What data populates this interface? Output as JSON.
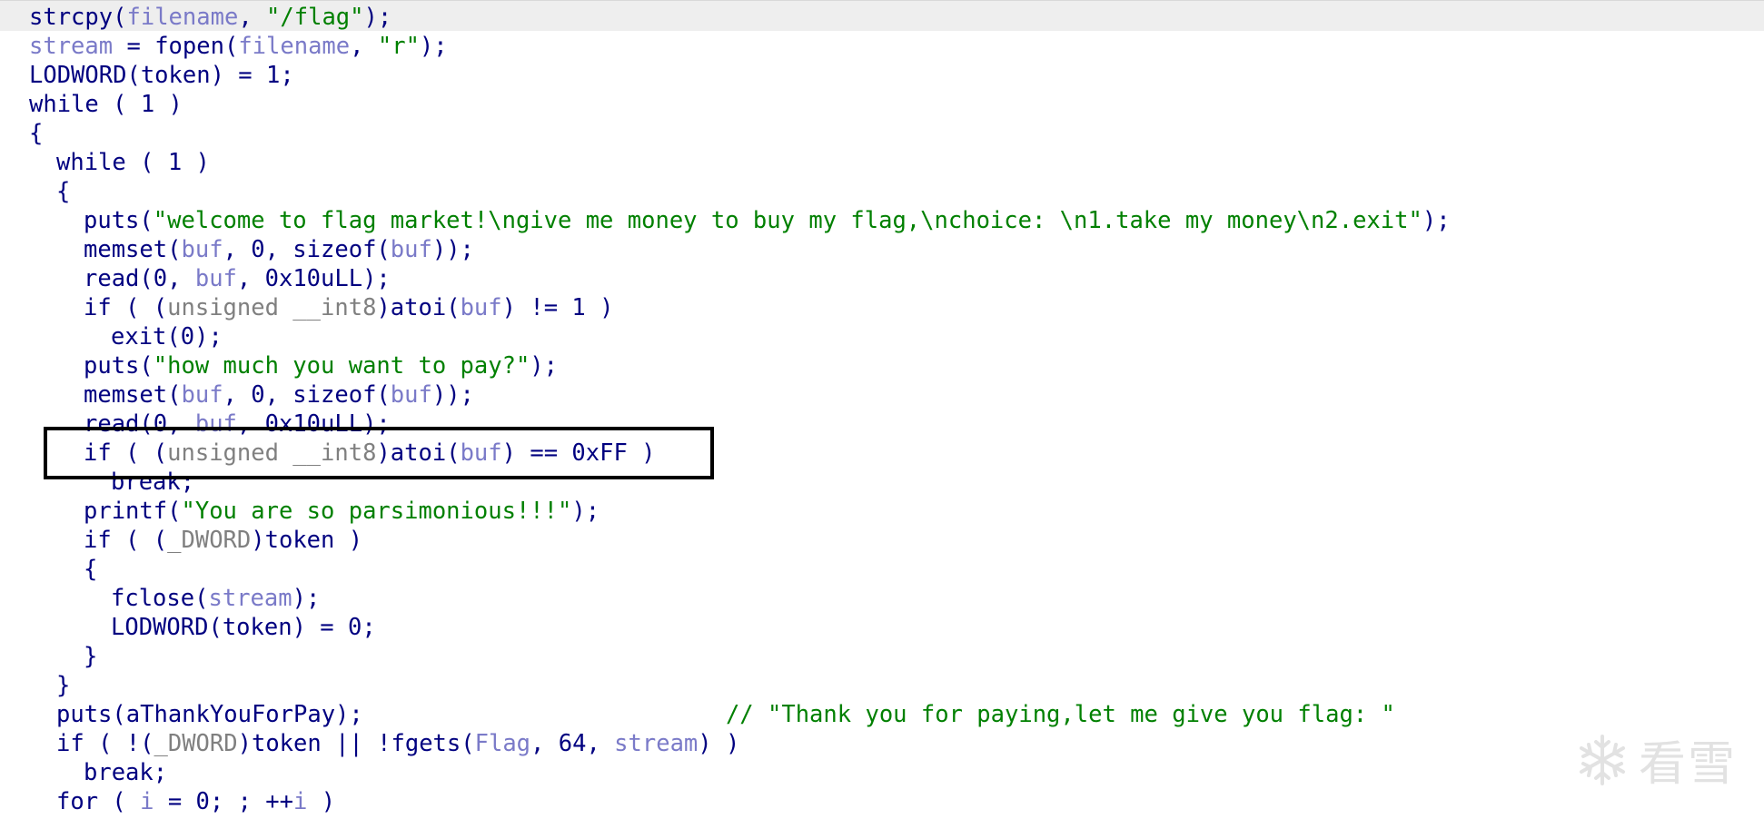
{
  "code_lines": [
    {
      "indent": 0,
      "tokens": [
        [
          "fn",
          "strcpy"
        ],
        [
          "p",
          "("
        ],
        [
          "var",
          "filename"
        ],
        [
          "p",
          ", "
        ],
        [
          "str",
          "\"/flag\""
        ],
        [
          "p",
          ");"
        ]
      ]
    },
    {
      "indent": 0,
      "tokens": [
        [
          "var",
          "stream"
        ],
        [
          "p",
          " = "
        ],
        [
          "fn",
          "fopen"
        ],
        [
          "p",
          "("
        ],
        [
          "var",
          "filename"
        ],
        [
          "p",
          ", "
        ],
        [
          "str",
          "\"r\""
        ],
        [
          "p",
          ");"
        ]
      ]
    },
    {
      "indent": 0,
      "tokens": [
        [
          "fn",
          "LODWORD"
        ],
        [
          "p",
          "(token) = 1;"
        ]
      ]
    },
    {
      "indent": 0,
      "tokens": [
        [
          "kw",
          "while"
        ],
        [
          "p",
          " ( 1 )"
        ]
      ]
    },
    {
      "indent": 0,
      "tokens": [
        [
          "p",
          "{"
        ]
      ]
    },
    {
      "indent": 1,
      "tokens": [
        [
          "kw",
          "while"
        ],
        [
          "p",
          " ( 1 )"
        ]
      ]
    },
    {
      "indent": 1,
      "tokens": [
        [
          "p",
          "{"
        ]
      ]
    },
    {
      "indent": 2,
      "tokens": [
        [
          "fn",
          "puts"
        ],
        [
          "p",
          "("
        ],
        [
          "str",
          "\"welcome to flag market!\\ngive me money to buy my flag,\\nchoice: \\n1.take my money\\n2.exit\""
        ],
        [
          "p",
          ");"
        ]
      ]
    },
    {
      "indent": 2,
      "tokens": [
        [
          "fn",
          "memset"
        ],
        [
          "p",
          "("
        ],
        [
          "var",
          "buf"
        ],
        [
          "p",
          ", 0, sizeof("
        ],
        [
          "var",
          "buf"
        ],
        [
          "p",
          "));"
        ]
      ]
    },
    {
      "indent": 2,
      "tokens": [
        [
          "fn",
          "read"
        ],
        [
          "p",
          "(0, "
        ],
        [
          "var",
          "buf"
        ],
        [
          "p",
          ", 0x10uLL);"
        ]
      ]
    },
    {
      "indent": 2,
      "tokens": [
        [
          "kw",
          "if"
        ],
        [
          "p",
          " ( ("
        ],
        [
          "type",
          "unsigned __int8"
        ],
        [
          "p",
          ")"
        ],
        [
          "fn",
          "atoi"
        ],
        [
          "p",
          "("
        ],
        [
          "var",
          "buf"
        ],
        [
          "p",
          ") != 1 )"
        ]
      ]
    },
    {
      "indent": 3,
      "tokens": [
        [
          "fn",
          "exit"
        ],
        [
          "p",
          "(0);"
        ]
      ]
    },
    {
      "indent": 2,
      "tokens": [
        [
          "fn",
          "puts"
        ],
        [
          "p",
          "("
        ],
        [
          "str",
          "\"how much you want to pay?\""
        ],
        [
          "p",
          ");"
        ]
      ]
    },
    {
      "indent": 2,
      "tokens": [
        [
          "fn",
          "memset"
        ],
        [
          "p",
          "("
        ],
        [
          "var",
          "buf"
        ],
        [
          "p",
          ", 0, sizeof("
        ],
        [
          "var",
          "buf"
        ],
        [
          "p",
          "));"
        ]
      ]
    },
    {
      "indent": 2,
      "tokens": [
        [
          "fn",
          "read"
        ],
        [
          "p",
          "(0, "
        ],
        [
          "var",
          "buf"
        ],
        [
          "p",
          ", 0x10uLL);"
        ]
      ]
    },
    {
      "indent": 2,
      "tokens": [
        [
          "kw",
          "if"
        ],
        [
          "p",
          " ( ("
        ],
        [
          "type",
          "unsigned __int8"
        ],
        [
          "p",
          ")"
        ],
        [
          "fn",
          "atoi"
        ],
        [
          "p",
          "("
        ],
        [
          "var",
          "buf"
        ],
        [
          "p",
          ") == 0xFF )"
        ]
      ]
    },
    {
      "indent": 3,
      "tokens": [
        [
          "kw",
          "break"
        ],
        [
          "p",
          ";"
        ]
      ]
    },
    {
      "indent": 2,
      "tokens": [
        [
          "fn",
          "printf"
        ],
        [
          "p",
          "("
        ],
        [
          "str",
          "\"You are so parsimonious!!!\""
        ],
        [
          "p",
          ");"
        ]
      ]
    },
    {
      "indent": 2,
      "tokens": [
        [
          "kw",
          "if"
        ],
        [
          "p",
          " ( ("
        ],
        [
          "type",
          "_DWORD"
        ],
        [
          "p",
          ")token )"
        ]
      ]
    },
    {
      "indent": 2,
      "tokens": [
        [
          "p",
          "{"
        ]
      ]
    },
    {
      "indent": 3,
      "tokens": [
        [
          "fn",
          "fclose"
        ],
        [
          "p",
          "("
        ],
        [
          "var",
          "stream"
        ],
        [
          "p",
          ");"
        ]
      ]
    },
    {
      "indent": 3,
      "tokens": [
        [
          "fn",
          "LODWORD"
        ],
        [
          "p",
          "(token) = 0;"
        ]
      ]
    },
    {
      "indent": 2,
      "tokens": [
        [
          "p",
          "}"
        ]
      ]
    },
    {
      "indent": 1,
      "tokens": [
        [
          "p",
          "}"
        ]
      ]
    },
    {
      "indent": 1,
      "tokens": [
        [
          "fn",
          "puts"
        ],
        [
          "p",
          "(aThankYouForPay);                          "
        ],
        [
          "cmt",
          "// \"Thank you for paying,let me give you flag: \""
        ]
      ]
    },
    {
      "indent": 1,
      "tokens": [
        [
          "kw",
          "if"
        ],
        [
          "p",
          " ( !("
        ],
        [
          "type",
          "_DWORD"
        ],
        [
          "p",
          ")token || !"
        ],
        [
          "fn",
          "fgets"
        ],
        [
          "p",
          "("
        ],
        [
          "var",
          "Flag"
        ],
        [
          "p",
          ", 64, "
        ],
        [
          "var",
          "stream"
        ],
        [
          "p",
          ") )"
        ]
      ]
    },
    {
      "indent": 2,
      "tokens": [
        [
          "kw",
          "break"
        ],
        [
          "p",
          ";"
        ]
      ]
    },
    {
      "indent": 1,
      "tokens": [
        [
          "kw",
          "for"
        ],
        [
          "p",
          " ( "
        ],
        [
          "var",
          "i"
        ],
        [
          "p",
          " = 0; ; ++"
        ],
        [
          "var",
          "i"
        ],
        [
          "p",
          " )"
        ]
      ]
    }
  ],
  "highlight": {
    "line_index": 15
  },
  "watermark": {
    "icon": "snowflake-icon",
    "text": "看雪"
  },
  "colors": {
    "function": "#000080",
    "variable": "#7a7ac8",
    "string": "#008000",
    "type": "#808080",
    "comment": "#008000",
    "current_line": "#eeeeee",
    "box_border": "#000000"
  }
}
